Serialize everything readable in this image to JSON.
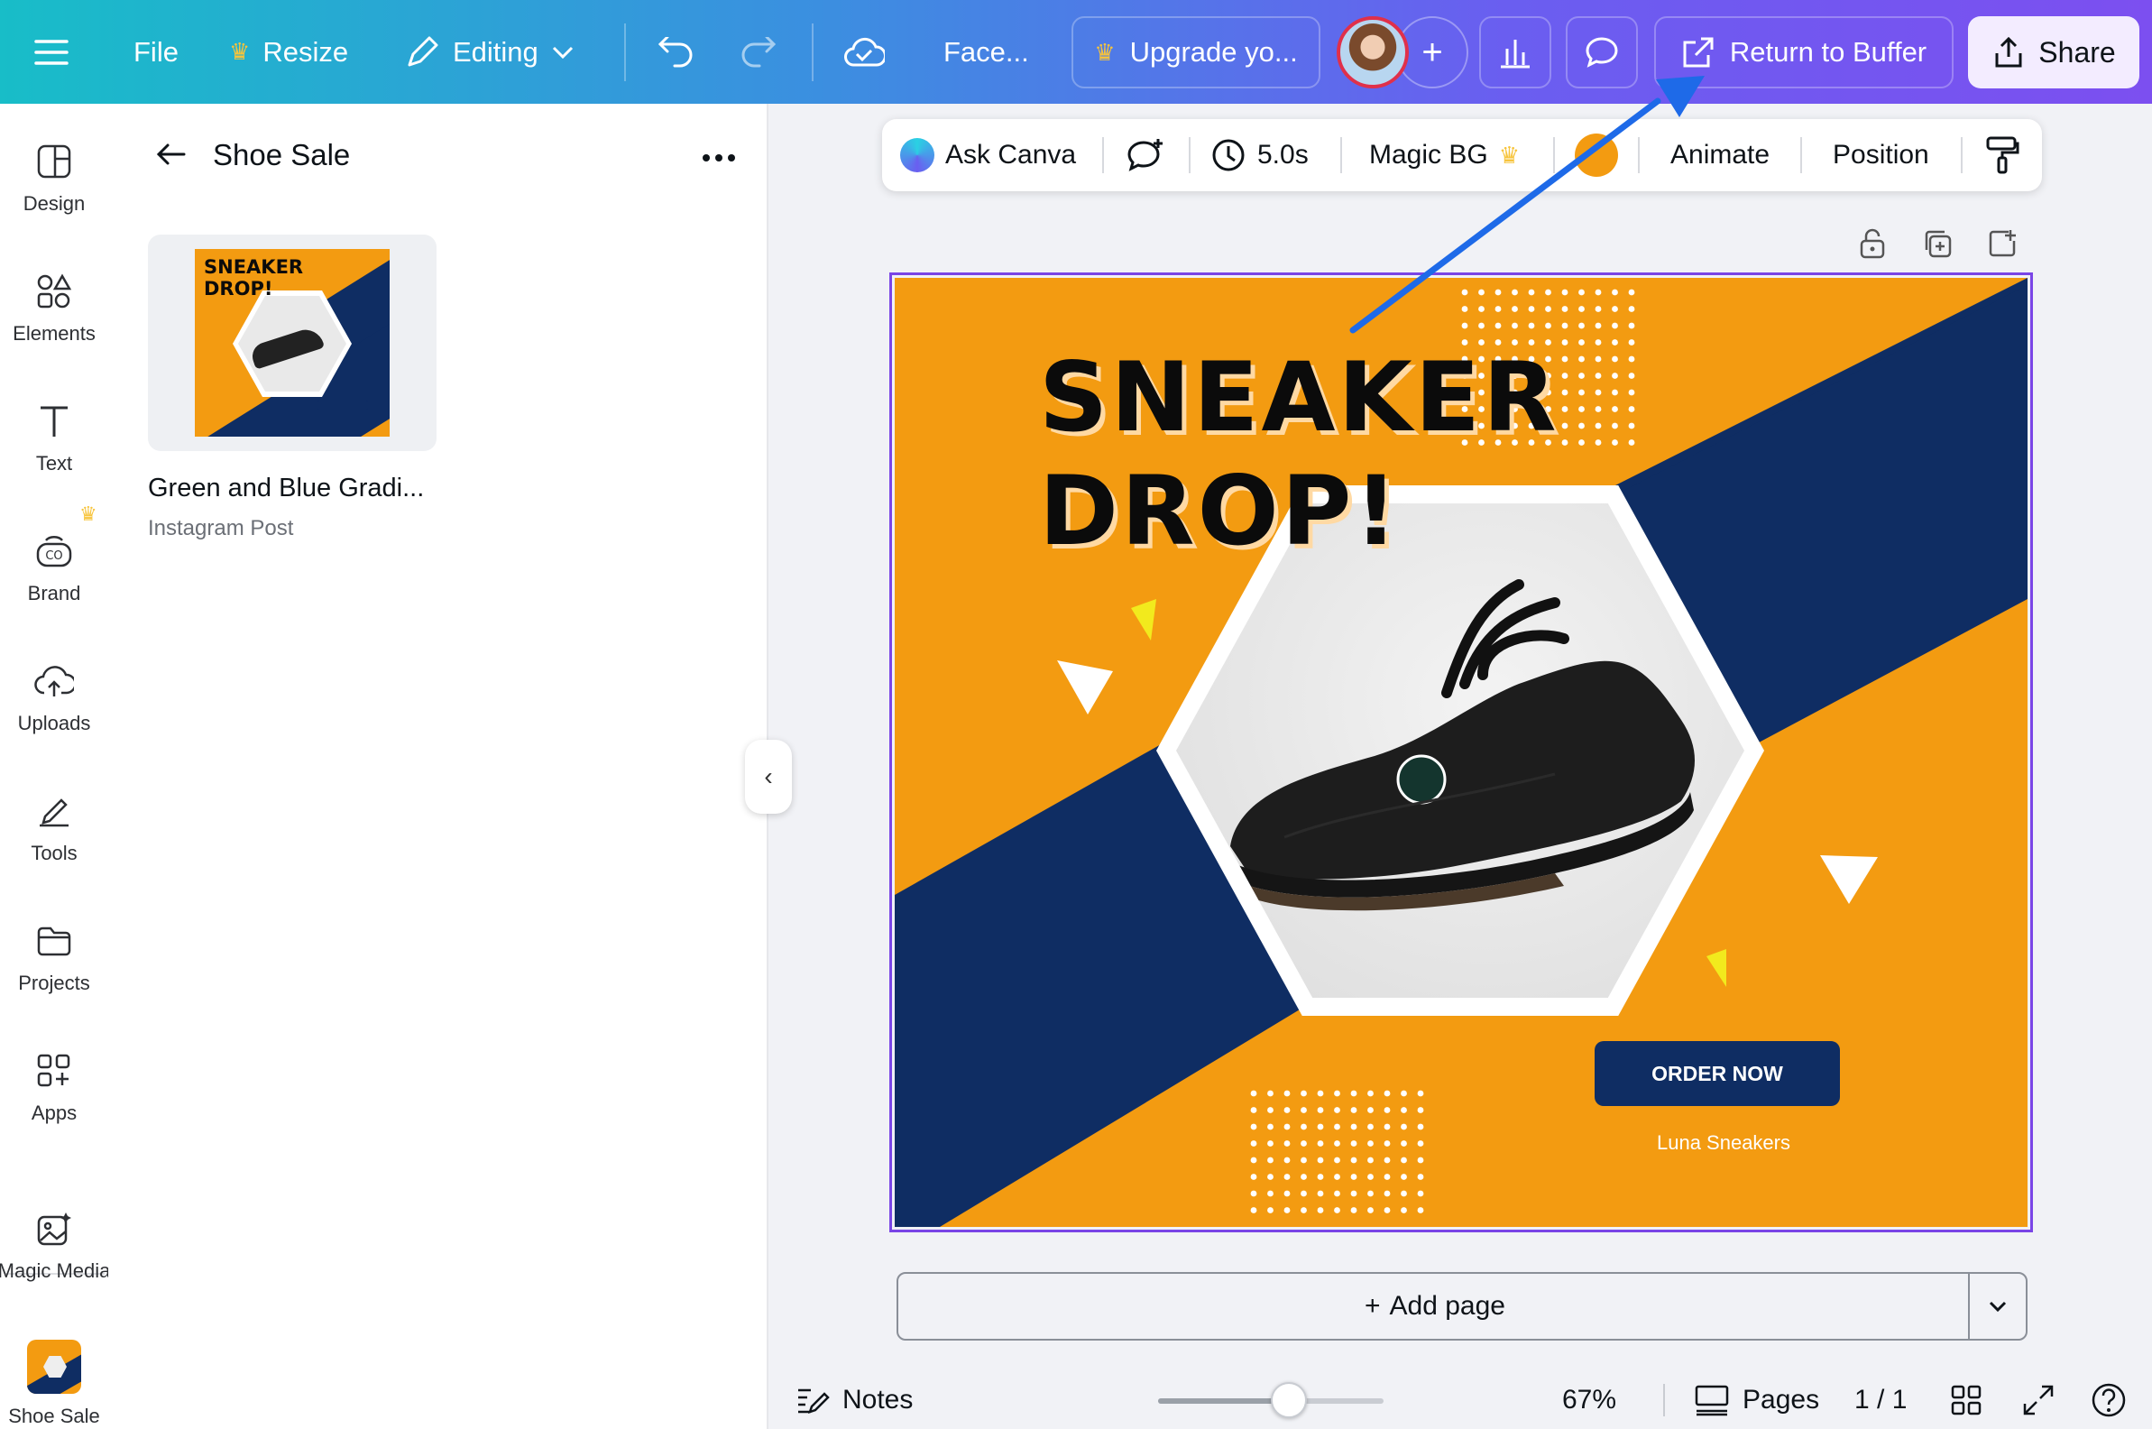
{
  "topbar": {
    "file": "File",
    "resize": "Resize",
    "editing": "Editing",
    "doc_title": "Face...",
    "upgrade": "Upgrade yo...",
    "return_to_buffer": "Return to Buffer",
    "share": "Share"
  },
  "rail": {
    "items": [
      {
        "label": "Design",
        "icon": "layout-icon"
      },
      {
        "label": "Elements",
        "icon": "shapes-icon"
      },
      {
        "label": "Text",
        "icon": "text-icon"
      },
      {
        "label": "Brand",
        "icon": "brand-icon"
      },
      {
        "label": "Uploads",
        "icon": "cloud-upload-icon"
      },
      {
        "label": "Tools",
        "icon": "pen-icon"
      },
      {
        "label": "Projects",
        "icon": "folder-icon"
      },
      {
        "label": "Apps",
        "icon": "apps-icon"
      },
      {
        "label": "Magic Media",
        "icon": "magic-media-icon"
      },
      {
        "label": "Shoe Sale",
        "icon": "project-thumb"
      }
    ]
  },
  "panel": {
    "title": "Shoe Sale",
    "card": {
      "title": "Green and Blue Gradi...",
      "subtitle": "Instagram Post",
      "thumb_text": "SNEAKER DROP!"
    }
  },
  "toolbar": {
    "ask_canva": "Ask Canva",
    "duration": "5.0s",
    "magic_bg": "Magic BG",
    "swatch_color": "#f39b11",
    "animate": "Animate",
    "position": "Position"
  },
  "design": {
    "headline_line1": "SNEAKER",
    "headline_line2": "DROP!",
    "cta": "ORDER NOW",
    "brand": "Luna Sneakers",
    "colors": {
      "orange": "#f39b11",
      "navy": "#0f2d63"
    }
  },
  "footer": {
    "add_page": "Add page",
    "notes": "Notes",
    "zoom": "67%",
    "zoom_fraction": 0.67,
    "pages": "Pages",
    "page_counter": "1 / 1"
  },
  "annotation": {
    "arrow_color": "#1e6ae8"
  }
}
